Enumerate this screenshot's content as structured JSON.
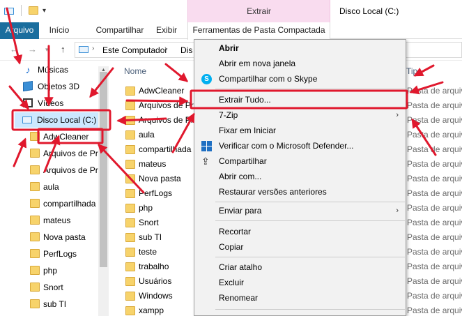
{
  "titlebar": {
    "context_tab_header": "Extrair",
    "window_title": "Disco Local (C:)"
  },
  "ribbon": {
    "tabs": [
      "Arquivo",
      "Início",
      "Compartilhar",
      "Exibir",
      "Ferramentas de Pasta Compactada"
    ]
  },
  "address": {
    "crumbs": [
      "Este Computador",
      "Dis"
    ]
  },
  "navpane": {
    "items": [
      "Músicas",
      "Objetos 3D",
      "Vídeos",
      "Disco Local (C:)",
      "AdwCleaner",
      "Arquivos de Pr",
      "Arquivos de Pr",
      "aula",
      "compartilhada",
      "mateus",
      "Nova pasta",
      "PerfLogs",
      "php",
      "Snort",
      "sub TI"
    ]
  },
  "filelist": {
    "col_name": "Nome",
    "col_type": "Tip",
    "files": [
      "AdwCleaner",
      "Arquivos de Pr",
      "Arquivos de Pr",
      "aula",
      "compartilhada",
      "mateus",
      "Nova pasta",
      "PerfLogs",
      "php",
      "Snort",
      "sub TI",
      "teste",
      "trabalho",
      "Usuários",
      "Windows",
      "xampp"
    ],
    "type_label": "Pasta de arquivo"
  },
  "context_menu": {
    "items": [
      "Abrir",
      "Abrir em nova janela",
      "Compartilhar com o Skype",
      "Extrair Tudo...",
      "7-Zip",
      "Fixar em Iniciar",
      "Verificar com o Microsoft Defender...",
      "Compartilhar",
      "Abrir com...",
      "Restaurar versões anteriores",
      "Enviar para",
      "Recortar",
      "Copiar",
      "Criar atalho",
      "Excluir",
      "Renomear"
    ]
  },
  "colors": {
    "accent_file_tab": "#1a6e9e",
    "context_tab": "#f9dcef",
    "annotation_red": "#e0182d",
    "selection": "#cce8ff"
  },
  "icons": [
    "drive-icon",
    "folder-icon",
    "music-icon",
    "objects-3d-icon",
    "video-icon",
    "skype-icon",
    "defender-icon",
    "share-icon",
    "submenu-arrow-icon"
  ]
}
